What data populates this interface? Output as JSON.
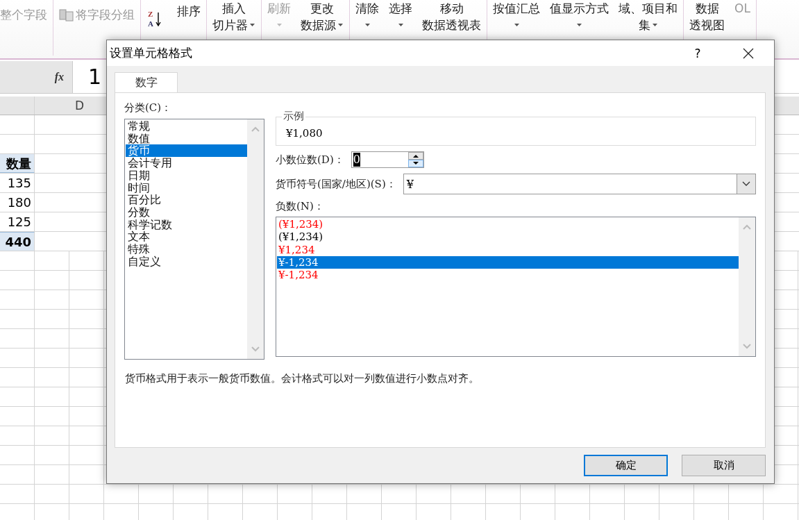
{
  "ribbon": {
    "groups": [
      [
        {
          "kind": "small",
          "lines": [
            "整个字段"
          ],
          "disabled": true
        }
      ],
      [
        {
          "kind": "small-icon",
          "lines": [
            "将字段分组"
          ],
          "disabled": true
        }
      ],
      [
        {
          "kind": "sort",
          "lines": [
            "排序"
          ],
          "icon_letters": [
            "Z",
            "A"
          ],
          "disabled": false
        }
      ],
      [
        {
          "kind": "large",
          "lines": [
            "插入",
            "切片器"
          ],
          "disabled": false,
          "dropdown": true
        }
      ],
      [
        {
          "kind": "large",
          "lines": [
            "刷新"
          ],
          "disabled": true,
          "dropdown": true
        },
        {
          "kind": "large",
          "lines": [
            "更改",
            "数据源"
          ],
          "disabled": false,
          "dropdown": true
        }
      ],
      [
        {
          "kind": "large",
          "lines": [
            "清除"
          ],
          "disabled": false,
          "dropdown": true
        },
        {
          "kind": "large",
          "lines": [
            "选择"
          ],
          "disabled": false,
          "dropdown": true
        },
        {
          "kind": "large",
          "lines": [
            "移动",
            "数据透视表"
          ],
          "disabled": false,
          "dropdown": false
        }
      ],
      [
        {
          "kind": "large",
          "lines": [
            "按值汇总"
          ],
          "disabled": false,
          "dropdown": true
        },
        {
          "kind": "large",
          "lines": [
            "值显示方式"
          ],
          "disabled": false,
          "dropdown": true
        },
        {
          "kind": "large",
          "lines": [
            "域、项目和",
            "集"
          ],
          "disabled": false,
          "dropdown": true
        }
      ],
      [
        {
          "kind": "large",
          "lines": [
            "数据",
            "透视图"
          ],
          "disabled": false,
          "dropdown": false
        },
        {
          "kind": "large",
          "lines": [
            "OL"
          ],
          "disabled": true,
          "dropdown": false
        }
      ]
    ]
  },
  "formula_bar": {
    "fx": "fx",
    "value": "1"
  },
  "sheet": {
    "column_header": "D",
    "rows": [
      {
        "kind": "empty",
        "value": ""
      },
      {
        "kind": "empty",
        "value": ""
      },
      {
        "kind": "header",
        "value": "数量"
      },
      {
        "kind": "normal",
        "value": "135"
      },
      {
        "kind": "normal",
        "value": "180"
      },
      {
        "kind": "normal",
        "value": "125"
      },
      {
        "kind": "total",
        "value": "440"
      }
    ]
  },
  "dialog": {
    "title": "设置单元格格式",
    "help": "?",
    "tabs": [
      {
        "label": "数字",
        "selected": true
      }
    ],
    "category_label": "分类(C)：",
    "categories": [
      {
        "label": "常规",
        "selected": false
      },
      {
        "label": "数值",
        "selected": false
      },
      {
        "label": "货币",
        "selected": true
      },
      {
        "label": "会计专用",
        "selected": false
      },
      {
        "label": "日期",
        "selected": false
      },
      {
        "label": "时间",
        "selected": false
      },
      {
        "label": "百分比",
        "selected": false
      },
      {
        "label": "分数",
        "selected": false
      },
      {
        "label": "科学记数",
        "selected": false
      },
      {
        "label": "文本",
        "selected": false
      },
      {
        "label": "特殊",
        "selected": false
      },
      {
        "label": "自定义",
        "selected": false
      }
    ],
    "sample": {
      "legend": "示例",
      "value": "¥1,080"
    },
    "decimals": {
      "label": "小数位数(D)：",
      "value": "0"
    },
    "currency": {
      "label": "货币符号(国家/地区)(S)：",
      "value": "¥"
    },
    "negative": {
      "label": "负数(N)：",
      "options": [
        {
          "label": "(¥1,234)",
          "color": "#ff0000",
          "selected": false
        },
        {
          "label": "(¥1,234)",
          "color": "#000000",
          "selected": false
        },
        {
          "label": "¥1,234",
          "color": "#ff0000",
          "selected": false
        },
        {
          "label": "¥-1,234",
          "selected": true
        },
        {
          "label": "¥-1,234",
          "color": "#ff0000",
          "selected": false
        }
      ]
    },
    "description": "货币格式用于表示一般货币数值。会计格式可以对一列数值进行小数点对齐。",
    "buttons": [
      {
        "label": "确定",
        "default": true
      },
      {
        "label": "取消",
        "default": false
      }
    ]
  }
}
